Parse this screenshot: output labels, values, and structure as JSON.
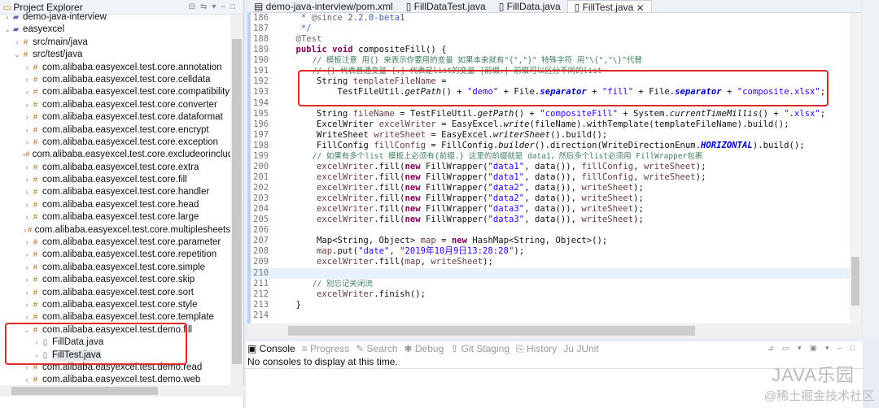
{
  "explorer": {
    "title": "Project Explorer",
    "items": [
      {
        "label": "demo-java-interview",
        "type": "proj",
        "level": 0,
        "state": ">"
      },
      {
        "label": "easyexcel",
        "type": "proj",
        "level": 0,
        "state": "v"
      },
      {
        "label": "src/main/java",
        "type": "pkg",
        "level": 1,
        "state": ">"
      },
      {
        "label": "src/test/java",
        "type": "pkg",
        "level": 1,
        "state": "v"
      },
      {
        "label": "com.alibaba.easyexcel.test.core.annotation",
        "type": "pkg",
        "level": 2,
        "state": ">"
      },
      {
        "label": "com.alibaba.easyexcel.test.core.celldata",
        "type": "pkg",
        "level": 2,
        "state": ">"
      },
      {
        "label": "com.alibaba.easyexcel.test.core.compatibility",
        "type": "pkg",
        "level": 2,
        "state": ">"
      },
      {
        "label": "com.alibaba.easyexcel.test.core.converter",
        "type": "pkg",
        "level": 2,
        "state": ">"
      },
      {
        "label": "com.alibaba.easyexcel.test.core.dataformat",
        "type": "pkg",
        "level": 2,
        "state": ">"
      },
      {
        "label": "com.alibaba.easyexcel.test.core.encrypt",
        "type": "pkg",
        "level": 2,
        "state": ">"
      },
      {
        "label": "com.alibaba.easyexcel.test.core.exception",
        "type": "pkg",
        "level": 2,
        "state": ">"
      },
      {
        "label": "com.alibaba.easyexcel.test.core.excludeorinclude",
        "type": "pkg",
        "level": 2,
        "state": ">"
      },
      {
        "label": "com.alibaba.easyexcel.test.core.extra",
        "type": "pkg",
        "level": 2,
        "state": ">"
      },
      {
        "label": "com.alibaba.easyexcel.test.core.fill",
        "type": "pkg",
        "level": 2,
        "state": ">"
      },
      {
        "label": "com.alibaba.easyexcel.test.core.handler",
        "type": "pkg",
        "level": 2,
        "state": ">"
      },
      {
        "label": "com.alibaba.easyexcel.test.core.head",
        "type": "pkg",
        "level": 2,
        "state": ">"
      },
      {
        "label": "com.alibaba.easyexcel.test.core.large",
        "type": "pkg",
        "level": 2,
        "state": ">"
      },
      {
        "label": "com.alibaba.easyexcel.test.core.multiplesheets",
        "type": "pkg",
        "level": 2,
        "state": ">"
      },
      {
        "label": "com.alibaba.easyexcel.test.core.parameter",
        "type": "pkg",
        "level": 2,
        "state": ">"
      },
      {
        "label": "com.alibaba.easyexcel.test.core.repetition",
        "type": "pkg",
        "level": 2,
        "state": ">"
      },
      {
        "label": "com.alibaba.easyexcel.test.core.simple",
        "type": "pkg",
        "level": 2,
        "state": ">"
      },
      {
        "label": "com.alibaba.easyexcel.test.core.skip",
        "type": "pkg",
        "level": 2,
        "state": ">"
      },
      {
        "label": "com.alibaba.easyexcel.test.core.sort",
        "type": "pkg",
        "level": 2,
        "state": ">"
      },
      {
        "label": "com.alibaba.easyexcel.test.core.style",
        "type": "pkg",
        "level": 2,
        "state": ">"
      },
      {
        "label": "com.alibaba.easyexcel.test.core.template",
        "type": "pkg",
        "level": 2,
        "state": ">"
      },
      {
        "label": "com.alibaba.easyexcel.test.demo.fill",
        "type": "pkg",
        "level": 2,
        "state": "v"
      },
      {
        "label": "FillData.java",
        "type": "jf",
        "level": 3,
        "state": ">"
      },
      {
        "label": "FillTest.java",
        "type": "jf",
        "level": 3,
        "state": ">",
        "selected": true
      },
      {
        "label": "com.alibaba.easyexcel.test.demo.read",
        "type": "pkg",
        "level": 2,
        "state": ">"
      },
      {
        "label": "com.alibaba.easyexcel.test.demo.web",
        "type": "pkg",
        "level": 2,
        "state": ">"
      }
    ]
  },
  "editor": {
    "tabs": [
      {
        "label": "demo-java-interview/pom.xml"
      },
      {
        "label": "FillDataTest.java"
      },
      {
        "label": "FillData.java"
      },
      {
        "label": "FillTest.java",
        "active": true
      }
    ],
    "lines": [
      {
        "n": "186",
        "t": [
          [
            "doc",
            "     * "
          ],
          [
            "ann",
            "@since"
          ],
          [
            "doc",
            " 2.2.0-beta1"
          ]
        ]
      },
      {
        "n": "187",
        "t": [
          [
            "doc",
            "     */"
          ]
        ]
      },
      {
        "n": "188",
        "t": [
          [
            "ann",
            "    @Test"
          ]
        ]
      },
      {
        "n": "189",
        "t": [
          [
            "kw",
            "    public void "
          ],
          [
            "",
            "compositeFill() {"
          ]
        ]
      },
      {
        "n": "190",
        "t": [
          [
            "cm",
            "        // 模板注意 用{} 来表示你要用的变量 如果本来就有\"{\",\"}\" 特殊字符 用\"\\{\",\"\\}\"代替"
          ]
        ]
      },
      {
        "n": "191",
        "t": [
          [
            "cm",
            "        // {} 代表普通变量 {.} 代表是list的变量 {前缀.} 前缀可以区分不同的list"
          ]
        ]
      },
      {
        "n": "192",
        "t": [
          [
            "",
            "        String "
          ],
          [
            "var",
            "templateFileName"
          ],
          [
            "",
            " ="
          ]
        ]
      },
      {
        "n": "193",
        "t": [
          [
            "",
            "            TestFileUtil."
          ],
          [
            "it",
            "getPath"
          ],
          [
            "",
            "() + "
          ],
          [
            "str",
            "\"demo\""
          ],
          [
            "",
            " + File."
          ],
          [
            "fld",
            "separator"
          ],
          [
            "",
            " + "
          ],
          [
            "str",
            "\"fill\""
          ],
          [
            "",
            " + File."
          ],
          [
            "fld",
            "separator"
          ],
          [
            "",
            " + "
          ],
          [
            "str",
            "\"composite.xlsx\""
          ],
          [
            "",
            ";"
          ]
        ]
      },
      {
        "n": "194",
        "t": []
      },
      {
        "n": "195",
        "t": [
          [
            "",
            "        String "
          ],
          [
            "var",
            "fileName"
          ],
          [
            "",
            " = TestFileUtil."
          ],
          [
            "it",
            "getPath"
          ],
          [
            "",
            "() + "
          ],
          [
            "str",
            "\"compositeFill\""
          ],
          [
            "",
            " + System."
          ],
          [
            "it",
            "currentTimeMillis"
          ],
          [
            "",
            "() + "
          ],
          [
            "str",
            "\".xlsx\""
          ],
          [
            "",
            ";"
          ]
        ]
      },
      {
        "n": "196",
        "t": [
          [
            "",
            "        ExcelWriter "
          ],
          [
            "var",
            "excelWriter"
          ],
          [
            "",
            " = EasyExcel."
          ],
          [
            "it",
            "write"
          ],
          [
            "",
            "(fileName).withTemplate(templateFileName).build();"
          ]
        ]
      },
      {
        "n": "197",
        "t": [
          [
            "",
            "        WriteSheet "
          ],
          [
            "var",
            "writeSheet"
          ],
          [
            "",
            " = EasyExcel."
          ],
          [
            "it",
            "writerSheet"
          ],
          [
            "",
            "().build();"
          ]
        ]
      },
      {
        "n": "198",
        "t": [
          [
            "",
            "        FillConfig "
          ],
          [
            "var",
            "fillConfig"
          ],
          [
            "",
            " = FillConfig."
          ],
          [
            "it",
            "builder"
          ],
          [
            "",
            "().direction(WriteDirectionEnum."
          ],
          [
            "fld",
            "HORIZONTAL"
          ],
          [
            "",
            ").build();"
          ]
        ]
      },
      {
        "n": "199",
        "t": [
          [
            "cm",
            "        // 如果有多个list 模板上必须有{前缀.} 这里的前缀就是 data1，然后多个list必须用 FillWrapper包裹"
          ]
        ]
      },
      {
        "n": "200",
        "t": [
          [
            "var",
            "        excelWriter"
          ],
          [
            "",
            ".fill("
          ],
          [
            "kw",
            "new"
          ],
          [
            "",
            " FillWrapper("
          ],
          [
            "str",
            "\"data1\""
          ],
          [
            "",
            ", data()), "
          ],
          [
            "var",
            "fillConfig"
          ],
          [
            "",
            ", "
          ],
          [
            "var",
            "writeSheet"
          ],
          [
            "",
            ");"
          ]
        ]
      },
      {
        "n": "201",
        "t": [
          [
            "var",
            "        excelWriter"
          ],
          [
            "",
            ".fill("
          ],
          [
            "kw",
            "new"
          ],
          [
            "",
            " FillWrapper("
          ],
          [
            "str",
            "\"data1\""
          ],
          [
            "",
            ", data()), "
          ],
          [
            "var",
            "fillConfig"
          ],
          [
            "",
            ", "
          ],
          [
            "var",
            "writeSheet"
          ],
          [
            "",
            ");"
          ]
        ]
      },
      {
        "n": "202",
        "t": [
          [
            "var",
            "        excelWriter"
          ],
          [
            "",
            ".fill("
          ],
          [
            "kw",
            "new"
          ],
          [
            "",
            " FillWrapper("
          ],
          [
            "str",
            "\"data2\""
          ],
          [
            "",
            ", data()), "
          ],
          [
            "var",
            "writeSheet"
          ],
          [
            "",
            ");"
          ]
        ]
      },
      {
        "n": "203",
        "t": [
          [
            "var",
            "        excelWriter"
          ],
          [
            "",
            ".fill("
          ],
          [
            "kw",
            "new"
          ],
          [
            "",
            " FillWrapper("
          ],
          [
            "str",
            "\"data2\""
          ],
          [
            "",
            ", data()), "
          ],
          [
            "var",
            "writeSheet"
          ],
          [
            "",
            ");"
          ]
        ]
      },
      {
        "n": "204",
        "t": [
          [
            "var",
            "        excelWriter"
          ],
          [
            "",
            ".fill("
          ],
          [
            "kw",
            "new"
          ],
          [
            "",
            " FillWrapper("
          ],
          [
            "str",
            "\"data3\""
          ],
          [
            "",
            ", data()), "
          ],
          [
            "var",
            "writeSheet"
          ],
          [
            "",
            ");"
          ]
        ]
      },
      {
        "n": "205",
        "t": [
          [
            "var",
            "        excelWriter"
          ],
          [
            "",
            ".fill("
          ],
          [
            "kw",
            "new"
          ],
          [
            "",
            " FillWrapper("
          ],
          [
            "str",
            "\"data3\""
          ],
          [
            "",
            ", data()), "
          ],
          [
            "var",
            "writeSheet"
          ],
          [
            "",
            ");"
          ]
        ]
      },
      {
        "n": "206",
        "t": []
      },
      {
        "n": "207",
        "t": [
          [
            "",
            "        Map<String, Object> "
          ],
          [
            "var",
            "map"
          ],
          [
            "",
            " = "
          ],
          [
            "kw",
            "new"
          ],
          [
            "",
            " HashMap<String, Object>();"
          ]
        ]
      },
      {
        "n": "208",
        "t": [
          [
            "var",
            "        map"
          ],
          [
            "",
            ".put("
          ],
          [
            "str",
            "\"date\""
          ],
          [
            "",
            ", "
          ],
          [
            "str",
            "\"2019年10月9日13:28:28\""
          ],
          [
            "",
            ");"
          ]
        ]
      },
      {
        "n": "209",
        "t": [
          [
            "var",
            "        excelWriter"
          ],
          [
            "",
            ".fill("
          ],
          [
            "var",
            "map"
          ],
          [
            "",
            ", "
          ],
          [
            "var",
            "writeSheet"
          ],
          [
            "",
            ");"
          ]
        ]
      },
      {
        "n": "210",
        "t": [],
        "current": true
      },
      {
        "n": "211",
        "t": [
          [
            "cm",
            "        // 别忘记关闭流"
          ]
        ]
      },
      {
        "n": "212",
        "t": [
          [
            "var",
            "        excelWriter"
          ],
          [
            "",
            ".finish();"
          ]
        ]
      },
      {
        "n": "213",
        "t": [
          [
            "",
            "    }"
          ]
        ]
      },
      {
        "n": "214",
        "t": []
      }
    ]
  },
  "console": {
    "tabs": [
      "Console",
      "Progress",
      "Search",
      "Debug",
      "Git Staging",
      "History",
      "JUnit"
    ],
    "message": "No consoles to display at this time."
  },
  "watermark": {
    "brand": "JAVA乐园",
    "site": "@稀土掘金技术社区"
  }
}
